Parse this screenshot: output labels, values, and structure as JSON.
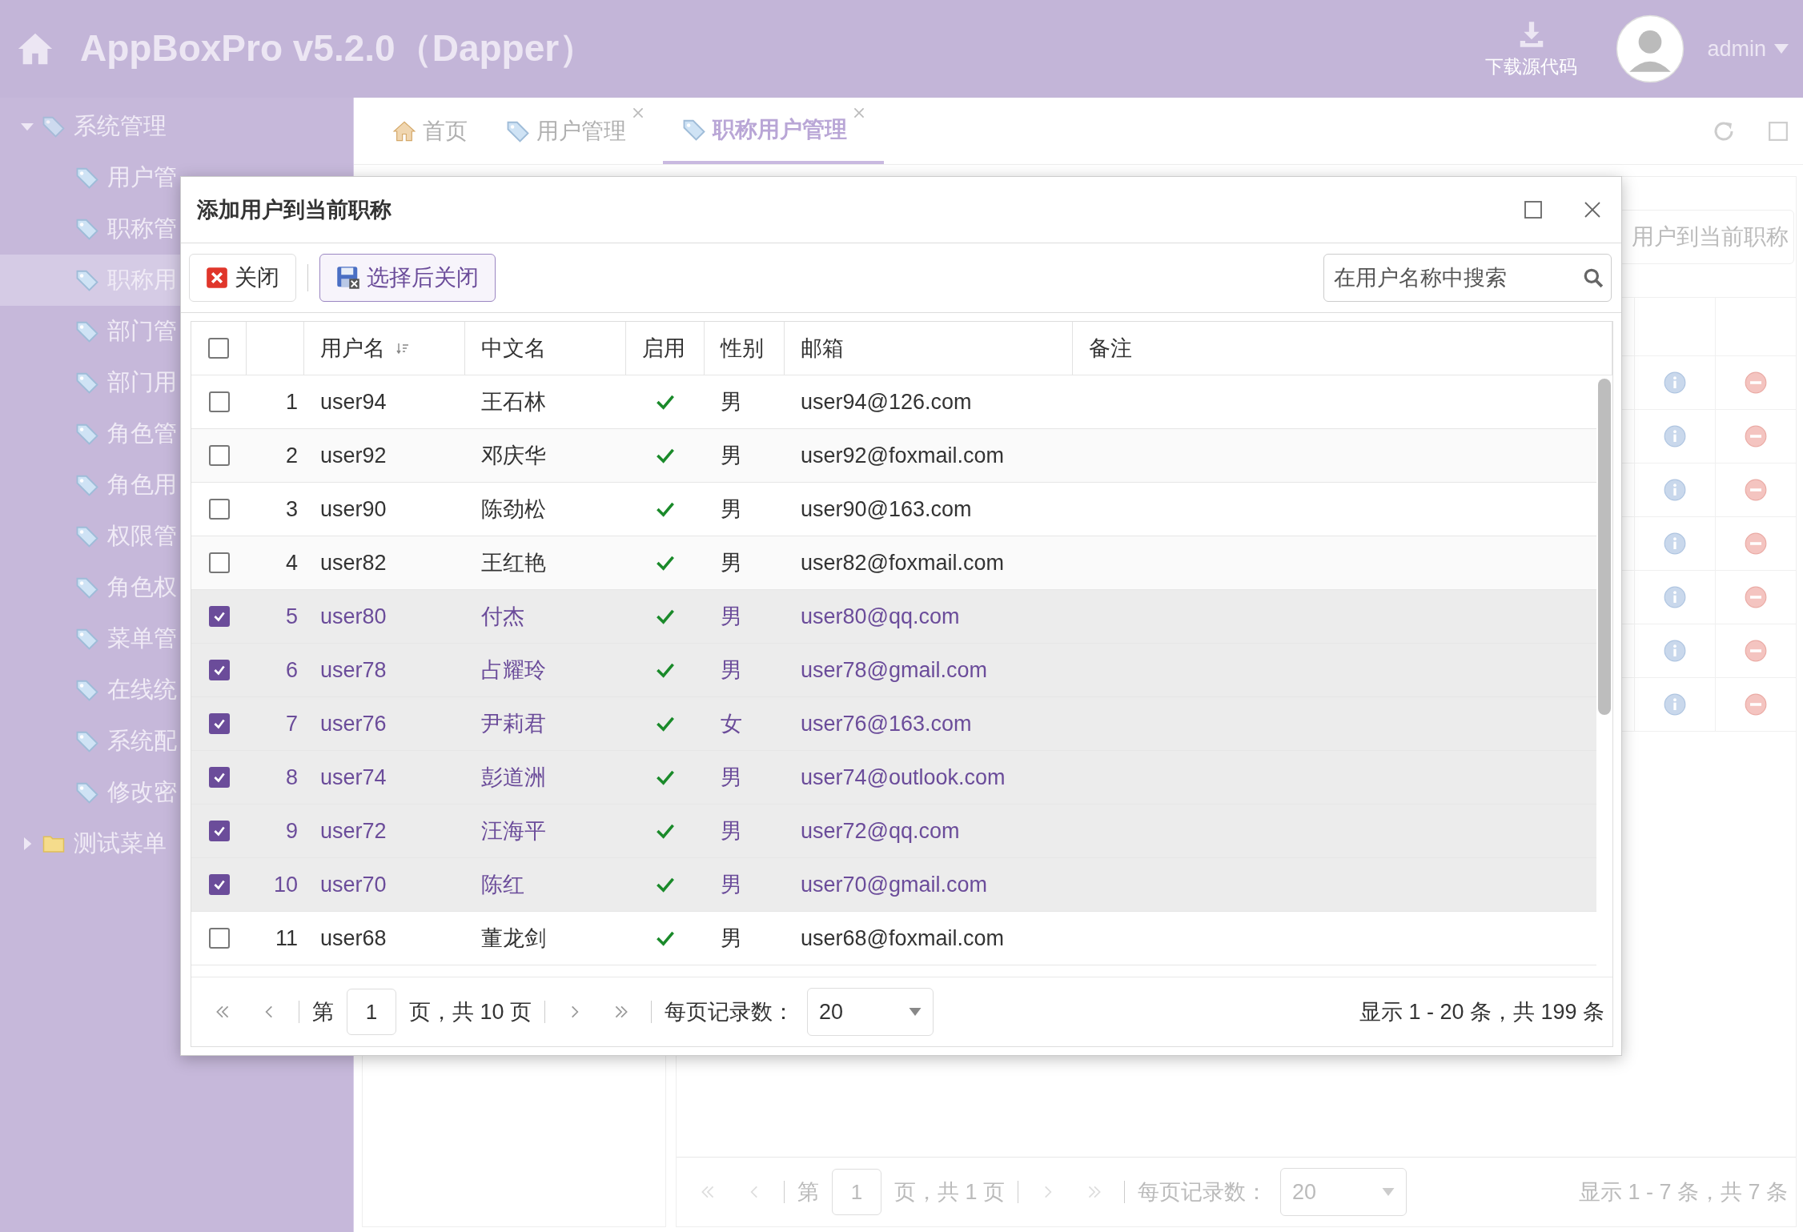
{
  "header": {
    "title": "AppBoxPro v5.2.0（Dapper）",
    "download_label": "下载源代码",
    "user_name": "admin"
  },
  "sidebar": {
    "items": [
      {
        "label": "系统管理",
        "kind": "tag",
        "expanded": true,
        "selected": false,
        "children": [
          {
            "label": "用户管",
            "kind": "tag",
            "selected": false
          },
          {
            "label": "职称管",
            "kind": "tag",
            "selected": false
          },
          {
            "label": "职称用",
            "kind": "tag",
            "selected": true
          },
          {
            "label": "部门管",
            "kind": "tag",
            "selected": false
          },
          {
            "label": "部门用",
            "kind": "tag",
            "selected": false
          },
          {
            "label": "角色管",
            "kind": "tag",
            "selected": false
          },
          {
            "label": "角色用",
            "kind": "tag",
            "selected": false
          },
          {
            "label": "权限管",
            "kind": "tag",
            "selected": false
          },
          {
            "label": "角色权",
            "kind": "tag",
            "selected": false
          },
          {
            "label": "菜单管",
            "kind": "tag",
            "selected": false
          },
          {
            "label": "在线统",
            "kind": "tag",
            "selected": false
          },
          {
            "label": "系统配",
            "kind": "tag",
            "selected": false
          },
          {
            "label": "修改密",
            "kind": "tag",
            "selected": false
          }
        ]
      },
      {
        "label": "测试菜单",
        "kind": "folder",
        "expanded": false,
        "selected": false
      }
    ]
  },
  "tabs": [
    {
      "label": "首页",
      "kind": "home",
      "selected": false,
      "closable": false
    },
    {
      "label": "用户管理",
      "kind": "tag",
      "selected": false,
      "closable": true
    },
    {
      "label": "职称用户管理",
      "kind": "tag",
      "selected": true,
      "closable": true
    }
  ],
  "background_panel": {
    "toolbar_button": "用户到当前职称",
    "rows": [
      {
        "kind": "actions"
      },
      {
        "kind": "actions"
      },
      {
        "kind": "actions"
      },
      {
        "kind": "actions"
      },
      {
        "kind": "actions"
      },
      {
        "kind": "actions"
      },
      {
        "kind": "actions"
      }
    ],
    "pager": {
      "page_prefix": "第",
      "page": "1",
      "page_suffix": "页，共 1 页",
      "per_page_label": "每页记录数：",
      "per_page": "20",
      "summary": "显示 1 - 7 条，共 7 条"
    }
  },
  "dialog": {
    "title": "添加用户到当前职称",
    "buttons": [
      {
        "label": "关闭",
        "kind": "close"
      },
      {
        "label": "选择后关闭",
        "kind": "select-close"
      }
    ],
    "search": {
      "placeholder": "在用户名称中搜索"
    },
    "select_all": {
      "checked": false
    },
    "columns": [
      {
        "label": "用户名",
        "sortable": true
      },
      {
        "label": "中文名",
        "sortable": false
      },
      {
        "label": "启用",
        "sortable": false
      },
      {
        "label": "性别",
        "sortable": false
      },
      {
        "label": "邮箱",
        "sortable": false
      },
      {
        "label": "备注",
        "sortable": false
      }
    ],
    "rows": [
      {
        "number": "1",
        "user": "user94",
        "name": "王石林",
        "enabled": true,
        "gender": "男",
        "email": "user94@126.com",
        "selected": false
      },
      {
        "number": "2",
        "user": "user92",
        "name": "邓庆华",
        "enabled": true,
        "gender": "男",
        "email": "user92@foxmail.com",
        "selected": false
      },
      {
        "number": "3",
        "user": "user90",
        "name": "陈劲松",
        "enabled": true,
        "gender": "男",
        "email": "user90@163.com",
        "selected": false
      },
      {
        "number": "4",
        "user": "user82",
        "name": "王红艳",
        "enabled": true,
        "gender": "男",
        "email": "user82@foxmail.com",
        "selected": false
      },
      {
        "number": "5",
        "user": "user80",
        "name": "付杰",
        "enabled": true,
        "gender": "男",
        "email": "user80@qq.com",
        "selected": true
      },
      {
        "number": "6",
        "user": "user78",
        "name": "占耀玲",
        "enabled": true,
        "gender": "男",
        "email": "user78@gmail.com",
        "selected": true
      },
      {
        "number": "7",
        "user": "user76",
        "name": "尹莉君",
        "enabled": true,
        "gender": "女",
        "email": "user76@163.com",
        "selected": true
      },
      {
        "number": "8",
        "user": "user74",
        "name": "彭道洲",
        "enabled": true,
        "gender": "男",
        "email": "user74@outlook.com",
        "selected": true
      },
      {
        "number": "9",
        "user": "user72",
        "name": "汪海平",
        "enabled": true,
        "gender": "男",
        "email": "user72@qq.com",
        "selected": true
      },
      {
        "number": "10",
        "user": "user70",
        "name": "陈红",
        "enabled": true,
        "gender": "男",
        "email": "user70@gmail.com",
        "selected": true
      },
      {
        "number": "11",
        "user": "user68",
        "name": "董龙剑",
        "enabled": true,
        "gender": "男",
        "email": "user68@foxmail.com",
        "selected": false
      }
    ],
    "pager": {
      "page_prefix": "第",
      "page": "1",
      "page_suffix": "页，共 10 页",
      "per_page_label": "每页记录数：",
      "per_page": "20",
      "summary": "显示 1 - 20 条，共 199 条"
    }
  }
}
